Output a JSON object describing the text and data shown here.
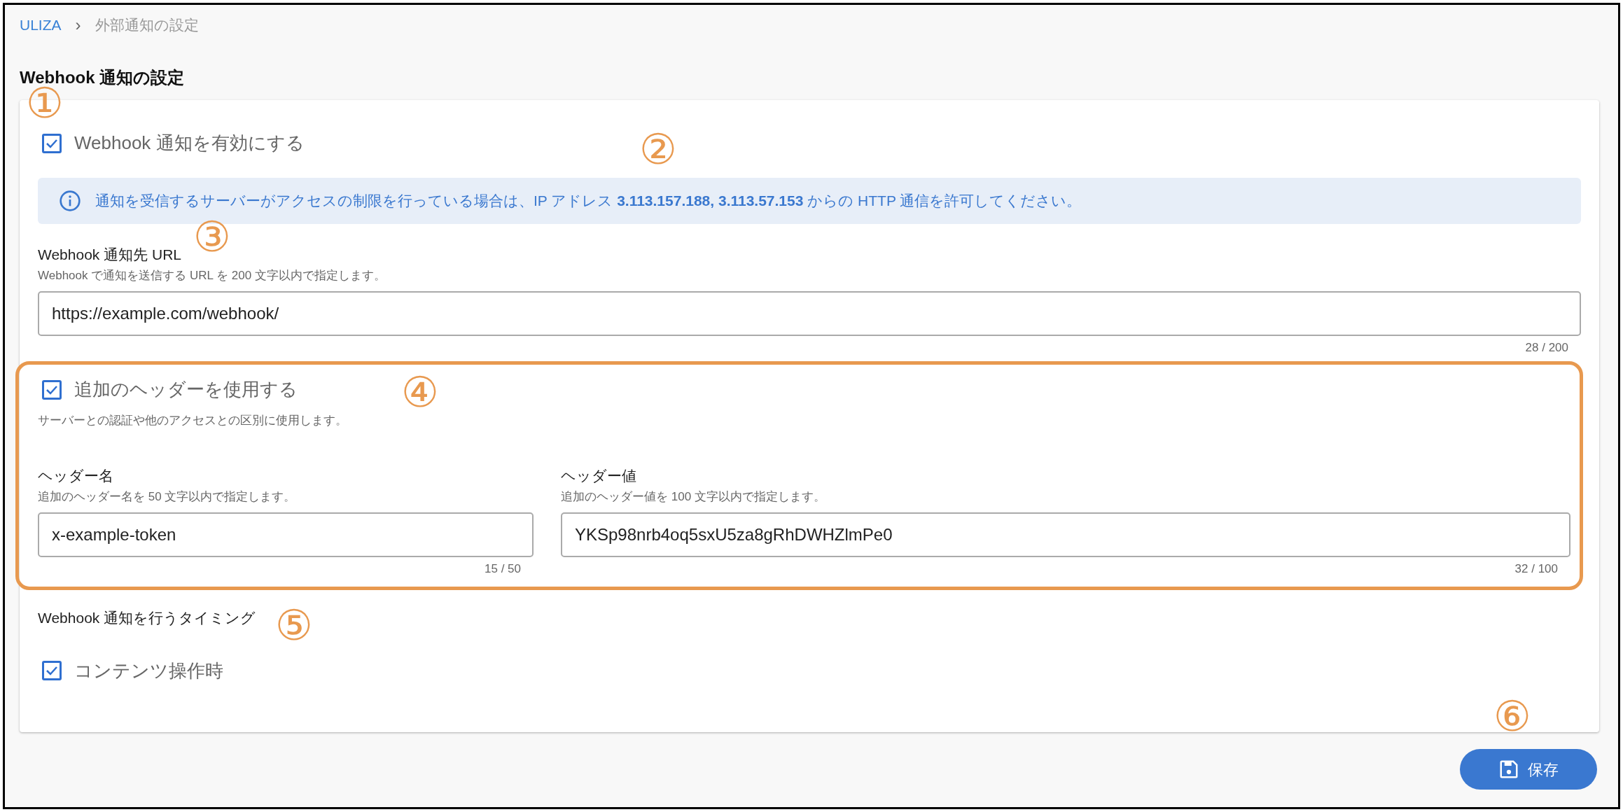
{
  "breadcrumb": [
    {
      "label": "ULIZA",
      "kind": "link"
    },
    {
      "label": "›",
      "kind": "separator"
    },
    {
      "label": "外部通知の設定",
      "kind": "current"
    }
  ],
  "title": "Webhook 通知の設定",
  "enable": {
    "label": "Webhook 通知を有効にする",
    "checked": true
  },
  "info": "通知を受信するサーバーがアクセスの制限を行っている場合は、IP アドレス **3.113.157.188, 3.113.57.153** からの HTTP 通信を許可してください。",
  "url_field": {
    "label": "Webhook 通知先 URL",
    "helper": "Webhook で通知を送信する URL を 200 文字以内で指定します。",
    "value": "https://example.com/webhook/",
    "counter": "28 / 200"
  },
  "headers": {
    "highlighted": true,
    "checkbox": {
      "label": "追加のヘッダーを使用する",
      "checked": true
    },
    "helper": "サーバーとの認証や他のアクセスとの区別に使用します。",
    "fields": [
      {
        "label": "ヘッダー名",
        "helper": "追加のヘッダー名を 50 文字以内で指定します。",
        "value": "x-example-token",
        "counter": "15 / 50"
      },
      {
        "label": "ヘッダー値",
        "helper": "追加のヘッダー値を 100 文字以内で指定します。",
        "value": "YKSp98nrb4oq5sxU5za8gRhDWHZlmPe0",
        "counter": "32 / 100"
      }
    ]
  },
  "timing": {
    "label": "Webhook 通知を行うタイミング",
    "options": [
      {
        "label": "コンテンツ操作時",
        "checked": true
      }
    ]
  },
  "save_button": "保存",
  "annotations": [
    "①",
    "②",
    "③",
    "④",
    "⑤",
    "⑥"
  ]
}
